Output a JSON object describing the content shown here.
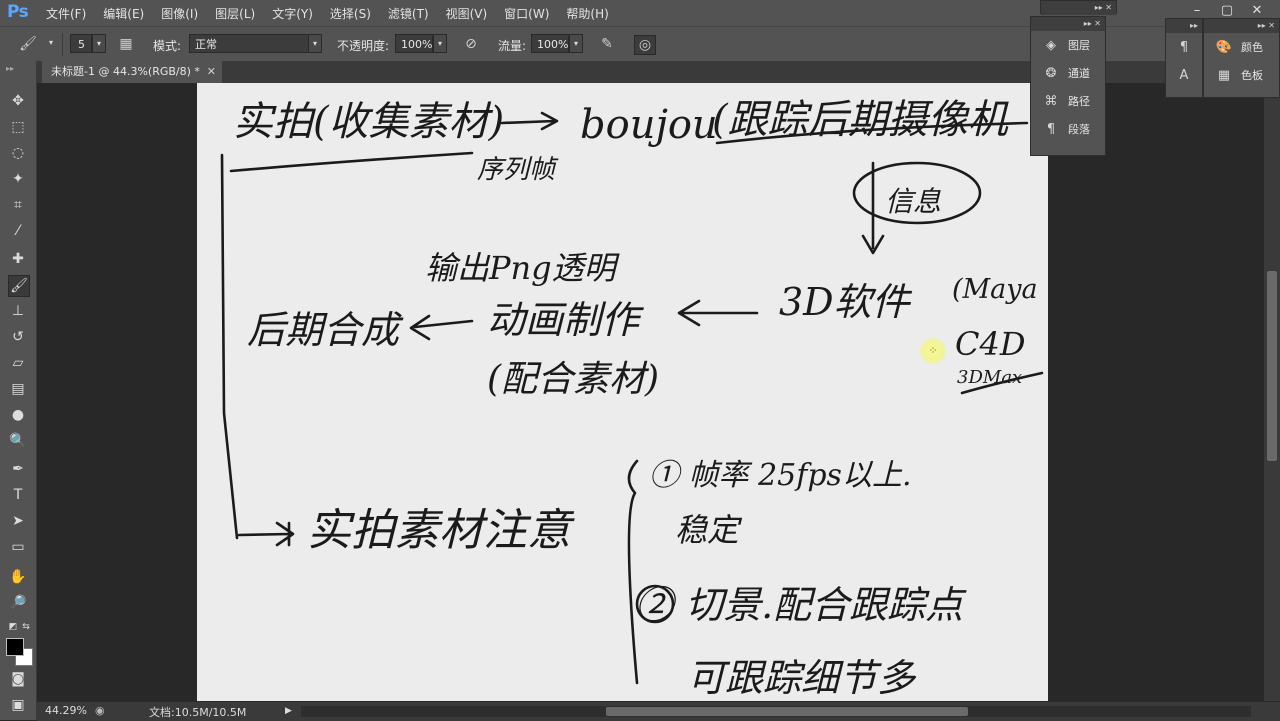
{
  "app": {
    "logo": "Ps",
    "menu": [
      "文件(F)",
      "编辑(E)",
      "图像(I)",
      "图层(L)",
      "文字(Y)",
      "选择(S)",
      "滤镜(T)",
      "视图(V)",
      "窗口(W)",
      "帮助(H)"
    ],
    "window_controls": [
      "–",
      "▢",
      "✕"
    ]
  },
  "options": {
    "brush_size": "5",
    "mode_label": "模式:",
    "mode_value": "正常",
    "opacity_label": "不透明度:",
    "opacity_value": "100%",
    "flow_label": "流量:",
    "flow_value": "100%"
  },
  "document": {
    "tab_title": "未标题-1 @ 44.3%(RGB/8) *",
    "tab_close": "✕"
  },
  "canvas_text": {
    "boujou": "boujou",
    "xulie": "序列帧",
    "shuchu": "输出Png透明",
    "xinxi": "信息",
    "sanD": "3D软件",
    "maya": "(Maya",
    "c4d": "C4D",
    "threedmax": "3DMax",
    "donghua": "动画制作",
    "peihe": "(配合素材)",
    "houqi": "后期合成",
    "shipai1": "实拍(收集素材)",
    "gensui": "(跟踪后期摄像机",
    "shipai2": "实拍素材注意",
    "item1": "① 帧率 25fps以上.",
    "wending": "稳定",
    "item2": "② 切景.配合跟踪点",
    "kegen": "可跟踪细节多"
  },
  "status": {
    "zoom": "44.29%",
    "doc_size": "文档:10.5M/10.5M"
  },
  "panels": {
    "layers_group": [
      {
        "icon": "layers-icon",
        "label": "图层"
      },
      {
        "icon": "channels-icon",
        "label": "通道"
      },
      {
        "icon": "paths-icon",
        "label": "路径"
      },
      {
        "icon": "paragraph-icon",
        "label": "段落"
      }
    ],
    "color_group": [
      {
        "icon": "palette-icon",
        "label": "颜色"
      },
      {
        "icon": "swatches-icon",
        "label": "色板"
      }
    ]
  }
}
